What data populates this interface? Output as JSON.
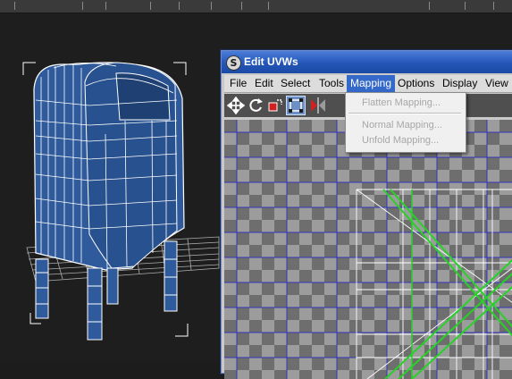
{
  "window": {
    "title": "Edit UVWs",
    "app_icon_glyph": "S"
  },
  "menubar": [
    {
      "label": "File"
    },
    {
      "label": "Edit"
    },
    {
      "label": "Select"
    },
    {
      "label": "Tools"
    },
    {
      "label": "Mapping",
      "active": true
    },
    {
      "label": "Options"
    },
    {
      "label": "Display"
    },
    {
      "label": "View"
    }
  ],
  "mapping_menu": {
    "items": [
      {
        "label": "Flatten Mapping...",
        "enabled": false
      },
      {
        "label": "Normal Mapping...",
        "enabled": false
      },
      {
        "label": "Unfold Mapping...",
        "enabled": false
      }
    ]
  },
  "toolbar": {
    "tools": [
      "move-icon",
      "rotate-icon",
      "scale-icon",
      "freeform-icon",
      "mirror-icon"
    ],
    "selected_tool": "freeform-icon"
  },
  "colors": {
    "title_bar": "#2456b8",
    "menu_highlight": "#3469c9",
    "mesh_fill": "#2f5b9c",
    "uv_edges_green": "#27d227",
    "uv_grid_blue": "#2727c8",
    "viewport_bg": "#1e1e1e"
  }
}
